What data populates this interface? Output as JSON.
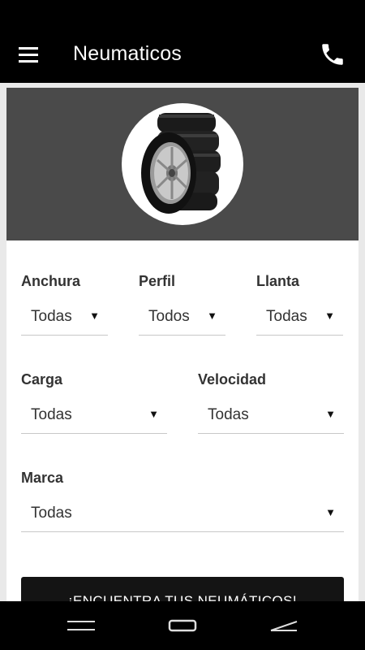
{
  "header": {
    "title": "Neumaticos"
  },
  "filters": {
    "anchura": {
      "label": "Anchura",
      "value": "Todas"
    },
    "perfil": {
      "label": "Perfil",
      "value": "Todos"
    },
    "llanta": {
      "label": "Llanta",
      "value": "Todas"
    },
    "carga": {
      "label": "Carga",
      "value": "Todas"
    },
    "velocidad": {
      "label": "Velocidad",
      "value": "Todas"
    },
    "marca": {
      "label": "Marca",
      "value": "Todas"
    }
  },
  "dropdown_arrow": "▼",
  "search_button": {
    "label": "¡ENCUENTRA TUS NEUMÁTICOS!"
  },
  "colors": {
    "appbar": "#000000",
    "banner": "#4a4a4a",
    "button": "#141414",
    "background": "#e9e9e9"
  },
  "icons": {
    "menu": "menu-icon",
    "phone": "phone-icon",
    "banner_image": "tire-stack-image",
    "nav_back": "back-icon",
    "nav_home": "home-icon",
    "nav_recent": "recent-apps-icon"
  }
}
